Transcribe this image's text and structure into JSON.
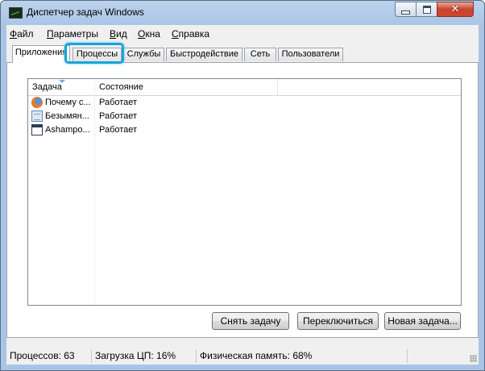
{
  "window": {
    "title": "Диспетчер задач Windows"
  },
  "menu": [
    {
      "pre": "",
      "u": "Ф",
      "post": "айл"
    },
    {
      "pre": "",
      "u": "П",
      "post": "араметры"
    },
    {
      "pre": "",
      "u": "В",
      "post": "ид"
    },
    {
      "pre": "",
      "u": "О",
      "post": "кна"
    },
    {
      "pre": "",
      "u": "С",
      "post": "правка"
    }
  ],
  "tabs": [
    "Приложения",
    "Процессы",
    "Службы",
    "Быстродействие",
    "Сеть",
    "Пользователи"
  ],
  "active_tab": "Приложения",
  "highlighted_tab": "Процессы",
  "list": {
    "columns": [
      "Задача",
      "Состояние"
    ],
    "rows": [
      {
        "task": "Почему с...",
        "status": "Работает",
        "icon": "firefox-icon"
      },
      {
        "task": "Безымян...",
        "status": "Работает",
        "icon": "notepad-icon"
      },
      {
        "task": "Ashampo...",
        "status": "Работает",
        "icon": "app-window-icon"
      }
    ]
  },
  "buttons": {
    "end_task": "Снять задачу",
    "switch_to": "Переключиться",
    "new_task": "Новая задача..."
  },
  "status": {
    "processes": "Процессов: 63",
    "cpu": "Загрузка ЦП: 16%",
    "memory": "Физическая память: 68%"
  },
  "colors": {
    "highlight": "#1ba3d9",
    "title_bar": "#a9c5e6",
    "close_button": "#c7452f"
  }
}
